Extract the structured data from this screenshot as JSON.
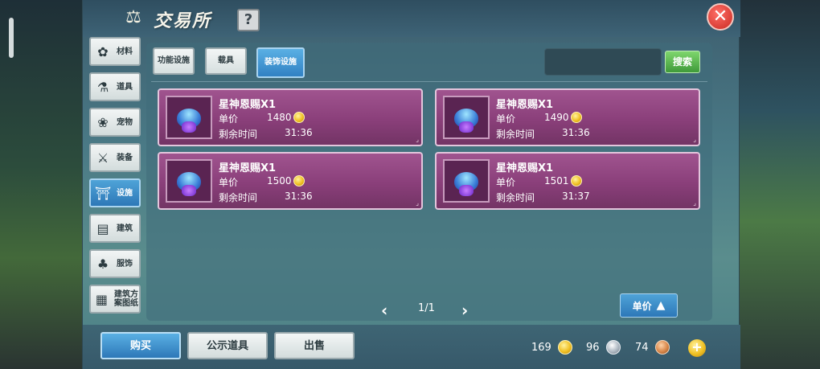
{
  "window": {
    "title": "交易所",
    "help_label": "?",
    "close_label": "✕"
  },
  "sidebar": {
    "items": [
      {
        "label": "材料",
        "icon": "materials-icon",
        "glyph": "✿"
      },
      {
        "label": "道具",
        "icon": "flask-icon",
        "glyph": "⚗"
      },
      {
        "label": "宠物",
        "icon": "paw-icon",
        "glyph": "❀"
      },
      {
        "label": "装备",
        "icon": "equipment-icon",
        "glyph": "⚔"
      },
      {
        "label": "设施",
        "icon": "facility-icon",
        "glyph": "⛩"
      },
      {
        "label": "建筑",
        "icon": "building-icon",
        "glyph": "▤"
      },
      {
        "label": "服饰",
        "icon": "clothing-icon",
        "glyph": "♣"
      },
      {
        "label": "建筑方案图纸",
        "icon": "blueprint-icon",
        "glyph": "▦"
      }
    ],
    "active_index": 4
  },
  "subtabs": [
    {
      "label": "功能设施"
    },
    {
      "label": "载具"
    },
    {
      "label": "装饰设施"
    }
  ],
  "search": {
    "placeholder": "",
    "button_label": "搜索"
  },
  "listings": [
    {
      "name": "星神恩赐X1",
      "price_label": "单价",
      "price": "1480",
      "time_label": "剩余时间",
      "time": "31:36"
    },
    {
      "name": "星神恩赐X1",
      "price_label": "单价",
      "price": "1490",
      "time_label": "剩余时间",
      "time": "31:36"
    },
    {
      "name": "星神恩赐X1",
      "price_label": "单价",
      "price": "1500",
      "time_label": "剩余时间",
      "time": "31:36"
    },
    {
      "name": "星神恩赐X1",
      "price_label": "单价",
      "price": "1501",
      "time_label": "剩余时间",
      "time": "31:37"
    }
  ],
  "pager": {
    "prev": "‹",
    "next": "›",
    "text": "1/1"
  },
  "sort": {
    "label": "单价",
    "arrow": "▲"
  },
  "bottom": {
    "buy_label": "购买",
    "public_label": "公示道具",
    "sell_label": "出售",
    "gold": "169",
    "silver": "96",
    "bronze": "74",
    "add_label": "+"
  },
  "colors": {
    "accent_blue": "#2d78b8",
    "card_purple": "#8a3f7a",
    "search_green": "#3f9a3a",
    "close_red": "#c92a22"
  }
}
